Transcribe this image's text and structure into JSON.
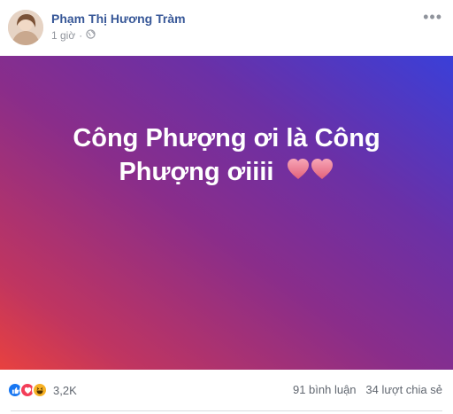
{
  "post": {
    "author": "Phạm Thị Hương Tràm",
    "time": "1 giờ",
    "dot": "·",
    "text_line1": "Công Phượng ơi là Công",
    "text_line2": "Phượng ơiiii"
  },
  "footer": {
    "reaction_count": "3,2K",
    "comments": "91 bình luận",
    "shares": "34 lượt chia sẻ"
  },
  "colors": {
    "link": "#385898",
    "meta": "#90949c",
    "like_blue": "#1877f2",
    "love_red": "#f33e58",
    "haha_yellow": "#f7b125"
  },
  "icons": [
    "globe-icon",
    "more-options-icon",
    "like-reaction-icon",
    "love-reaction-icon",
    "haha-reaction-icon",
    "heart-emoji-icon"
  ]
}
